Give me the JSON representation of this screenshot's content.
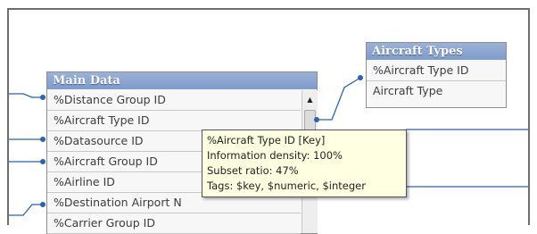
{
  "main_table": {
    "title": "Main Data",
    "fields": [
      "%Distance Group ID",
      "%Aircraft Type ID",
      "%Datasource ID",
      "%Aircraft Group ID",
      "%Airline ID",
      "%Destination Airport N",
      "%Carrier Group ID"
    ]
  },
  "aircraft_table": {
    "title": "Aircraft Types",
    "fields": [
      "%Aircraft Type ID",
      "Aircraft Type"
    ]
  },
  "tooltip": {
    "lines": [
      "%Aircraft Type ID [Key]",
      "Information density: 100%",
      "Subset ratio: 47%",
      "Tags: $key, $numeric, $integer"
    ]
  },
  "colors": {
    "link": "#2a62b8",
    "header": "#8aa6d2",
    "tooltip_bg": "#ffffe1"
  }
}
